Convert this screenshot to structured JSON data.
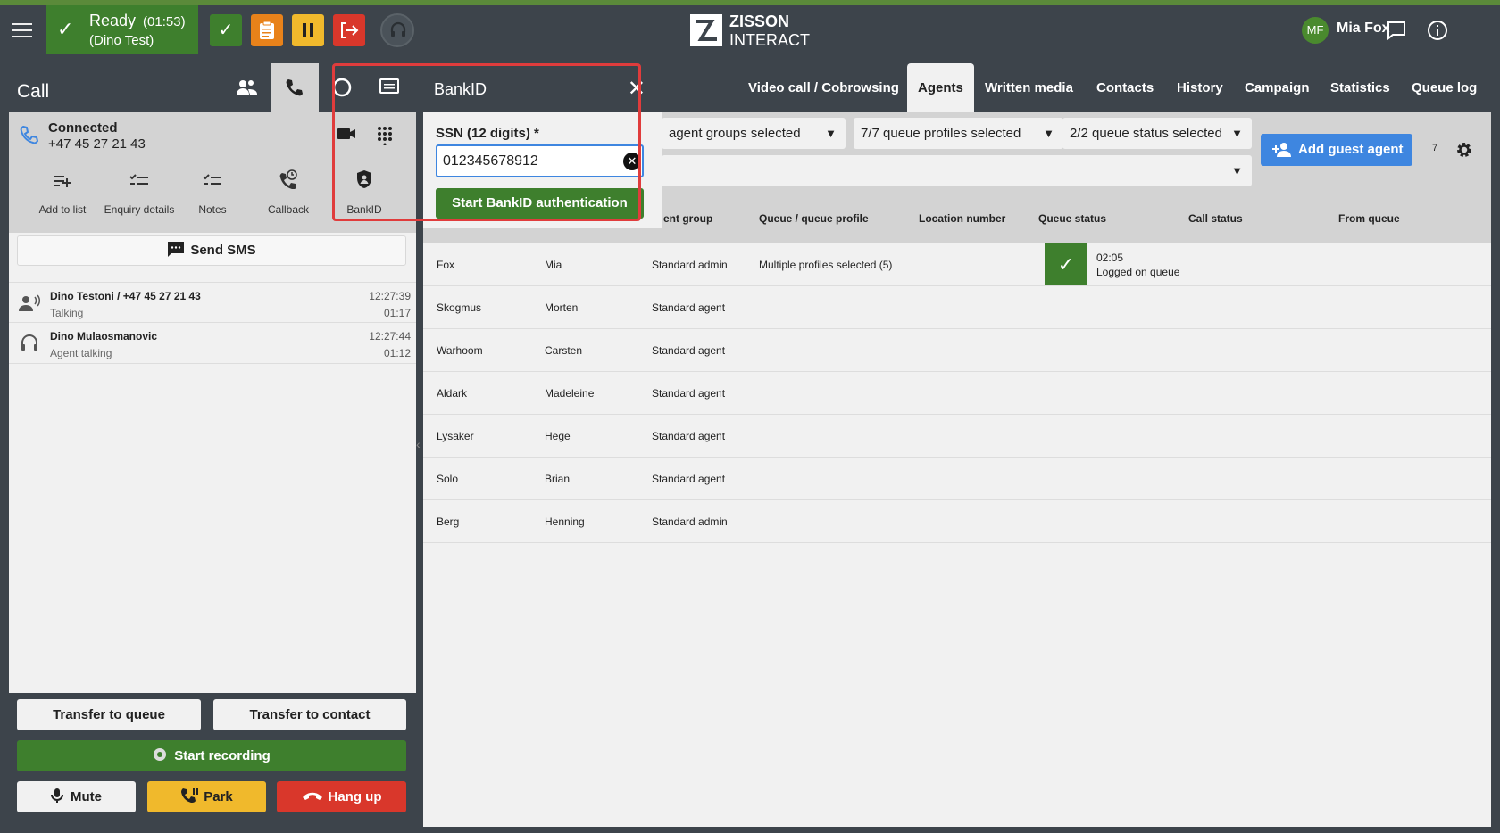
{
  "topbar": {
    "status_label": "Ready",
    "status_timer": "(01:53)",
    "status_sub": "(Dino Test)",
    "logo_line1": "ZISSON",
    "logo_line2": "INTERACT",
    "avatar_initials": "MF",
    "user_name": "Mia Fox",
    "colors": {
      "ready": "#3e7f2d",
      "checklist": "#e8821a",
      "pause": "#f0b92c",
      "logout": "#d9372b"
    }
  },
  "call_panel": {
    "title": "Call",
    "connection_status": "Connected",
    "connection_number": "+47 45 27 21 43",
    "actions": [
      "Add to list",
      "Enquiry details",
      "Notes",
      "Callback",
      "BankID"
    ],
    "send_sms": "Send SMS",
    "calls": [
      {
        "name": "Dino Testoni / +47 45 27 21 43",
        "status": "Talking",
        "time": "12:27:39",
        "duration": "01:17"
      },
      {
        "name": "Dino Mulaosmanovic",
        "status": "Agent talking",
        "time": "12:27:44",
        "duration": "01:12"
      }
    ],
    "transfer_queue": "Transfer to queue",
    "transfer_contact": "Transfer to contact",
    "start_recording": "Start recording",
    "mute": "Mute",
    "park": "Park",
    "hang_up": "Hang up"
  },
  "bankid": {
    "title": "BankID",
    "ssn_label": "SSN (12 digits) *",
    "ssn_value": "012345678912",
    "start_button": "Start BankID authentication"
  },
  "tabs": [
    "Video call / Cobrowsing",
    "Agents",
    "Written media",
    "Contacts",
    "History",
    "Campaign",
    "Statistics",
    "Queue log"
  ],
  "active_tab": "Agents",
  "filters": {
    "agent_groups": "agent groups selected",
    "queue_profiles": "7/7 queue profiles selected",
    "queue_status": "2/2 queue status selected",
    "add_guest": "Add guest agent",
    "count": "7"
  },
  "table": {
    "headers": [
      "ent group",
      "Queue / queue profile",
      "Location number",
      "Queue status",
      "Call status",
      "From queue"
    ],
    "rows": [
      {
        "last": "Fox",
        "first": "Mia",
        "group": "Standard admin",
        "profile": "Multiple profiles selected (5)",
        "time": "02:05",
        "qstatus": "Logged on queue"
      },
      {
        "last": "Skogmus",
        "first": "Morten",
        "group": "Standard agent"
      },
      {
        "last": "Warhoom",
        "first": "Carsten",
        "group": "Standard agent"
      },
      {
        "last": "Aldark",
        "first": "Madeleine",
        "group": "Standard agent"
      },
      {
        "last": "Lysaker",
        "first": "Hege",
        "group": "Standard agent"
      },
      {
        "last": "Solo",
        "first": "Brian",
        "group": "Standard agent"
      },
      {
        "last": "Berg",
        "first": "Henning",
        "group": "Standard admin"
      }
    ]
  }
}
